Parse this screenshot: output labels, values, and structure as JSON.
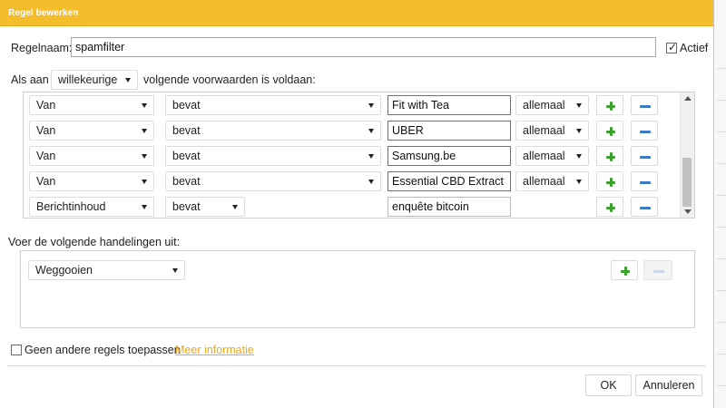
{
  "dialog": {
    "title": "Regel bewerken"
  },
  "rule": {
    "name_label": "Regelnaam:",
    "name_value": "spamfilter",
    "active_label": "Actief",
    "active_checked": true
  },
  "match": {
    "prefix": "Als aan",
    "mode": "willekeurige",
    "suffix": "volgende voorwaarden is voldaan:"
  },
  "conditions": [
    {
      "field": "Van",
      "operator": "bevat",
      "value": "Fit with Tea",
      "scope": "allemaal"
    },
    {
      "field": "Van",
      "operator": "bevat",
      "value": "UBER",
      "scope": "allemaal"
    },
    {
      "field": "Van",
      "operator": "bevat",
      "value": "Samsung.be",
      "scope": "allemaal"
    },
    {
      "field": "Van",
      "operator": "bevat",
      "value": "Essential CBD Extract",
      "scope": "allemaal"
    },
    {
      "field": "Berichtinhoud",
      "operator": "bevat",
      "value": "enquête bitcoin",
      "scope": ""
    }
  ],
  "actions_section": {
    "label": "Voer de volgende handelingen uit:",
    "action": "Weggooien"
  },
  "footer": {
    "stop_label": "Geen andere regels toepassen",
    "more_info": "Meer informatie",
    "ok": "OK",
    "cancel": "Annuleren"
  },
  "colors": {
    "title_bar": "#f5bd2b",
    "plus": "#3aa12b",
    "minus": "#3a78c9",
    "link": "#f0a81c"
  }
}
